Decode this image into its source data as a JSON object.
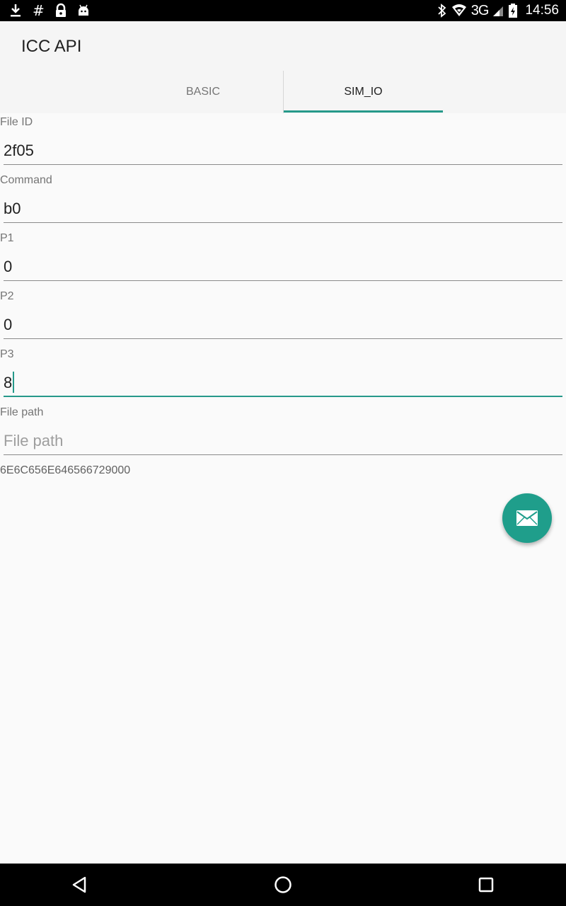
{
  "status_bar": {
    "left_icons": [
      "download-icon",
      "hash-icon",
      "lock-icon",
      "android-icon"
    ],
    "hash_glyph": "#",
    "network": "3G",
    "time": "14:56"
  },
  "app": {
    "title": "ICC API"
  },
  "tabs": [
    {
      "label": "BASIC",
      "selected": false
    },
    {
      "label": "SIM_IO",
      "selected": true
    }
  ],
  "form": {
    "fields": [
      {
        "label": "File ID",
        "value": "2f05"
      },
      {
        "label": "Command",
        "value": "b0"
      },
      {
        "label": "P1",
        "value": "0"
      },
      {
        "label": "P2",
        "value": "0"
      },
      {
        "label": "P3",
        "value": "8"
      },
      {
        "label": "File path",
        "value": "",
        "placeholder": "File path"
      }
    ],
    "result": "6E6C656E646566729000"
  },
  "fab": {
    "icon": "envelope-icon"
  },
  "colors": {
    "accent": "#26998a",
    "fab": "#1f9e8b"
  }
}
